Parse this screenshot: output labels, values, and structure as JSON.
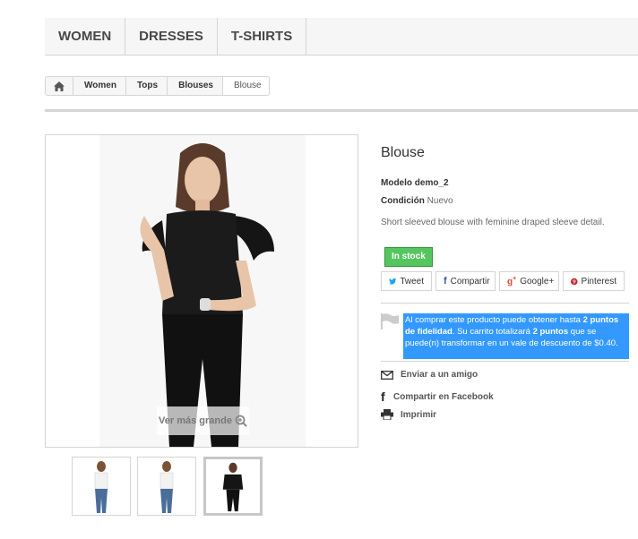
{
  "menu": {
    "items": [
      "WOMEN",
      "DRESSES",
      "T-SHIRTS"
    ]
  },
  "breadcrumb": {
    "items": [
      "Women",
      "Tops",
      "Blouses"
    ],
    "current": "Blouse"
  },
  "image": {
    "zoom_label": "Ver más grande"
  },
  "product": {
    "title": "Blouse",
    "model_label": "Modelo",
    "model_value": "demo_2",
    "condition_label": "Condición",
    "condition_value": "Nuevo",
    "description": "Short sleeved blouse with feminine draped sleeve detail.",
    "stock": "In stock"
  },
  "share": {
    "tweet": "Tweet",
    "facebook": "Compartir",
    "google": "Google+",
    "pinterest": "Pinterest"
  },
  "loyalty": {
    "t1": "Al comprar este producto puede obtener hasta ",
    "points": "2 puntos de fidelidad",
    "t2": ". Su carrito totalizará ",
    "points2": "2 puntos",
    "t3": " que se puede(n) transformar en un vale de descuento de $0.40."
  },
  "actions": {
    "friend": "Enviar a un amigo",
    "facebook": "Compartir en Facebook",
    "print": "Imprimir"
  },
  "colors": {
    "stock_green": "#55c65e",
    "loyalty_blue": "#3399ff"
  }
}
